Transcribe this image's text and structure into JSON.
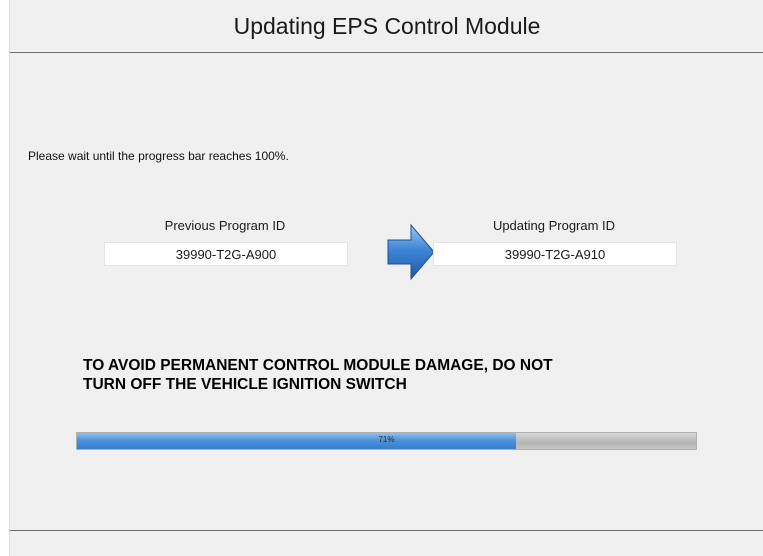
{
  "window": {
    "title": "Updating EPS Control Module"
  },
  "instruction": "Please wait until the progress bar reaches 100%.",
  "program": {
    "previous_label": "Previous Program ID",
    "previous_value": "39990-T2G-A900",
    "updating_label": "Updating Program ID",
    "updating_value": "39990-T2G-A910",
    "arrow_icon": "arrow-right-icon"
  },
  "warning": {
    "line1": "TO AVOID PERMANENT CONTROL MODULE DAMAGE, DO NOT",
    "line2": "TURN OFF THE VEHICLE IGNITION SWITCH"
  },
  "progress": {
    "percent": 71,
    "label": "71%"
  },
  "colors": {
    "progress_fill": "#4a8fd8",
    "arrow": "#2f6fc0"
  }
}
